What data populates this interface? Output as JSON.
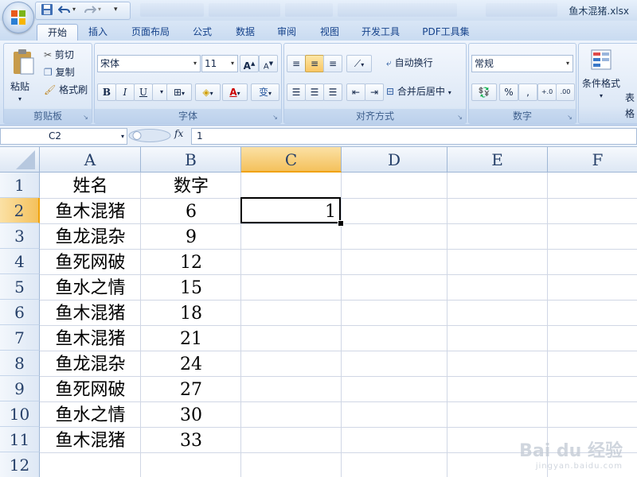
{
  "window": {
    "title": "鱼木混猪.xlsx"
  },
  "tabs": [
    "开始",
    "插入",
    "页面布局",
    "公式",
    "数据",
    "审阅",
    "视图",
    "开发工具",
    "PDF工具集"
  ],
  "ribbon": {
    "clipboard": {
      "label": "剪贴板",
      "paste": "粘贴",
      "cut": "剪切",
      "copy": "复制",
      "format_painter": "格式刷"
    },
    "font": {
      "label": "字体",
      "name": "宋体",
      "size": "11",
      "bold": "B",
      "italic": "I",
      "underline": "U",
      "grow": "A",
      "shrink": "A"
    },
    "alignment": {
      "label": "对齐方式",
      "wrap": "自动换行",
      "merge": "合并后居中"
    },
    "number": {
      "label": "数字",
      "format": "常规",
      "percent": "%",
      "comma": ","
    },
    "styles": {
      "conditional": "条件格式",
      "table": "表格"
    }
  },
  "formula_bar": {
    "name_box": "C2",
    "fx": "fx",
    "value": "1"
  },
  "sheet": {
    "columns": [
      "A",
      "B",
      "C",
      "D",
      "E",
      "F"
    ],
    "rows": [
      "1",
      "2",
      "3",
      "4",
      "5",
      "6",
      "7",
      "8",
      "9",
      "10",
      "11",
      "12"
    ],
    "header": {
      "name": "姓名",
      "number": "数字"
    },
    "data": [
      {
        "name": "鱼木混猪",
        "number": "6"
      },
      {
        "name": "鱼龙混杂",
        "number": "9"
      },
      {
        "name": "鱼死网破",
        "number": "12"
      },
      {
        "name": "鱼水之情",
        "number": "15"
      },
      {
        "name": "鱼木混猪",
        "number": "18"
      },
      {
        "name": "鱼木混猪",
        "number": "21"
      },
      {
        "name": "鱼龙混杂",
        "number": "24"
      },
      {
        "name": "鱼死网破",
        "number": "27"
      },
      {
        "name": "鱼水之情",
        "number": "30"
      },
      {
        "name": "鱼木混猪",
        "number": "33"
      }
    ],
    "c2_value": "1",
    "active_cell": "C2"
  },
  "watermark": {
    "brand": "Bai du 经验",
    "url": "jingyan.baidu.com"
  }
}
